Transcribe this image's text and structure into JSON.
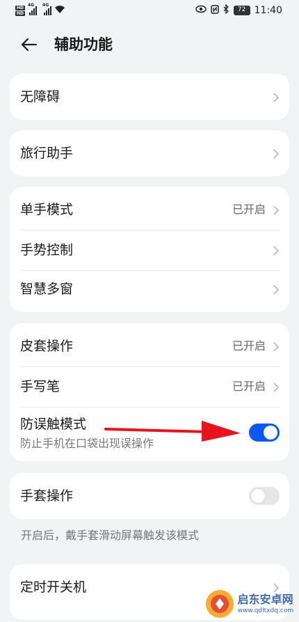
{
  "status_bar": {
    "hd_badges": [
      "HD",
      "HD"
    ],
    "sim1_network": "4G",
    "sim2_network": "4G",
    "wifi_icon": "wifi-icon",
    "eye_icon": "eye-comfort-icon",
    "nfc_icon": "nfc-icon",
    "bluetooth_icon": "bluetooth-icon",
    "battery": "72",
    "time": "11:40"
  },
  "header": {
    "back_icon": "back-arrow-icon",
    "title": "辅助功能"
  },
  "cards": {
    "accessibility": {
      "label": "无障碍"
    },
    "travel": {
      "label": "旅行助手"
    },
    "group1": {
      "one_hand": {
        "label": "单手模式",
        "value": "已开启"
      },
      "gesture": {
        "label": "手势控制"
      },
      "multi_window": {
        "label": "智慧多窗"
      }
    },
    "group2": {
      "cover": {
        "label": "皮套操作",
        "value": "已开启"
      },
      "stylus": {
        "label": "手写笔",
        "value": "已开启"
      },
      "pocket_mode": {
        "label": "防误触模式",
        "description": "防止手机在口袋出现误操作",
        "enabled": true
      }
    },
    "glove": {
      "label": "手套操作",
      "enabled": false,
      "hint": "开启后，戴手套滑动屏幕触发该模式"
    },
    "timer_power": {
      "label": "定时开关机"
    }
  },
  "colors": {
    "accent": "#0a59f7",
    "background": "#f1f3f5",
    "card": "#ffffff",
    "annotation_arrow": "#e8141b"
  },
  "watermark": {
    "name": "启东安卓网",
    "url": "www.qdltxdq.com"
  }
}
